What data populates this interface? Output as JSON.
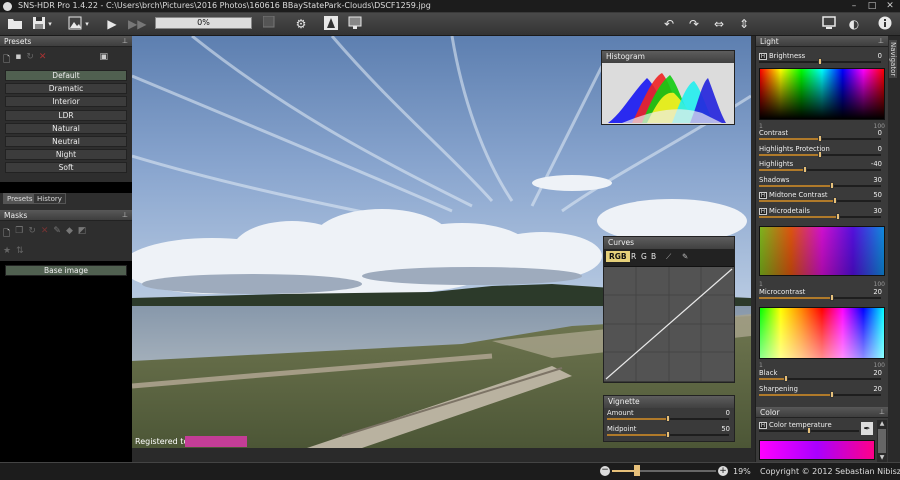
{
  "window": {
    "title": "SNS-HDR Pro 1.4.22 - C:\\Users\\brch\\Pictures\\2016 Photos\\160616 BBayStatePark-Clouds\\DSCF1259.jpg"
  },
  "toolbar": {
    "progress": "0%"
  },
  "presets": {
    "title": "Presets",
    "items": [
      "Default",
      "Dramatic",
      "Interior",
      "LDR",
      "Natural",
      "Neutral",
      "Night",
      "Soft"
    ],
    "selected": "Default",
    "tabs": [
      "Presets",
      "History"
    ]
  },
  "masks": {
    "title": "Masks",
    "item": "Base image"
  },
  "photo": {
    "registered": "Registered to"
  },
  "histogram": {
    "title": "Histogram"
  },
  "curves": {
    "title": "Curves",
    "channels": [
      "RGB",
      "R",
      "G",
      "B"
    ],
    "selected": "RGB"
  },
  "vignette": {
    "title": "Vignette",
    "amount": {
      "label": "Amount",
      "value": "0",
      "pct": 0.5
    },
    "midpoint": {
      "label": "Midpoint",
      "value": "50",
      "pct": 0.5
    }
  },
  "light": {
    "title": "Light",
    "brightness": {
      "label": "Brightness",
      "value": "0"
    },
    "scale_min": "1",
    "scale_max": "100",
    "sliders": [
      {
        "label": "Contrast",
        "value": "0",
        "pct": 0.5,
        "toggle": false
      },
      {
        "label": "Highlights Protection",
        "value": "0",
        "pct": 0.5,
        "toggle": false
      },
      {
        "label": "Highlights",
        "value": "-40",
        "pct": 0.38,
        "toggle": false
      },
      {
        "label": "Shadows",
        "value": "30",
        "pct": 0.6,
        "toggle": false
      },
      {
        "label": "Midtone Contrast",
        "value": "50",
        "pct": 0.62,
        "toggle": true
      },
      {
        "label": "Microdetails",
        "value": "30",
        "pct": 0.65,
        "toggle": true
      }
    ],
    "microcontrast": {
      "label": "Microcontrast",
      "value": "20",
      "pct": 0.6
    },
    "black": {
      "label": "Black",
      "value": "20",
      "pct": 0.22
    },
    "sharpening": {
      "label": "Sharpening",
      "value": "20",
      "pct": 0.6
    }
  },
  "color": {
    "title": "Color",
    "temperature": {
      "label": "Color temperature",
      "value": "0"
    }
  },
  "navigator": {
    "label": "Navigator"
  },
  "status": {
    "zoom": "19%",
    "copyright": "Copyright © 2012 Sebastian Nibisz"
  }
}
